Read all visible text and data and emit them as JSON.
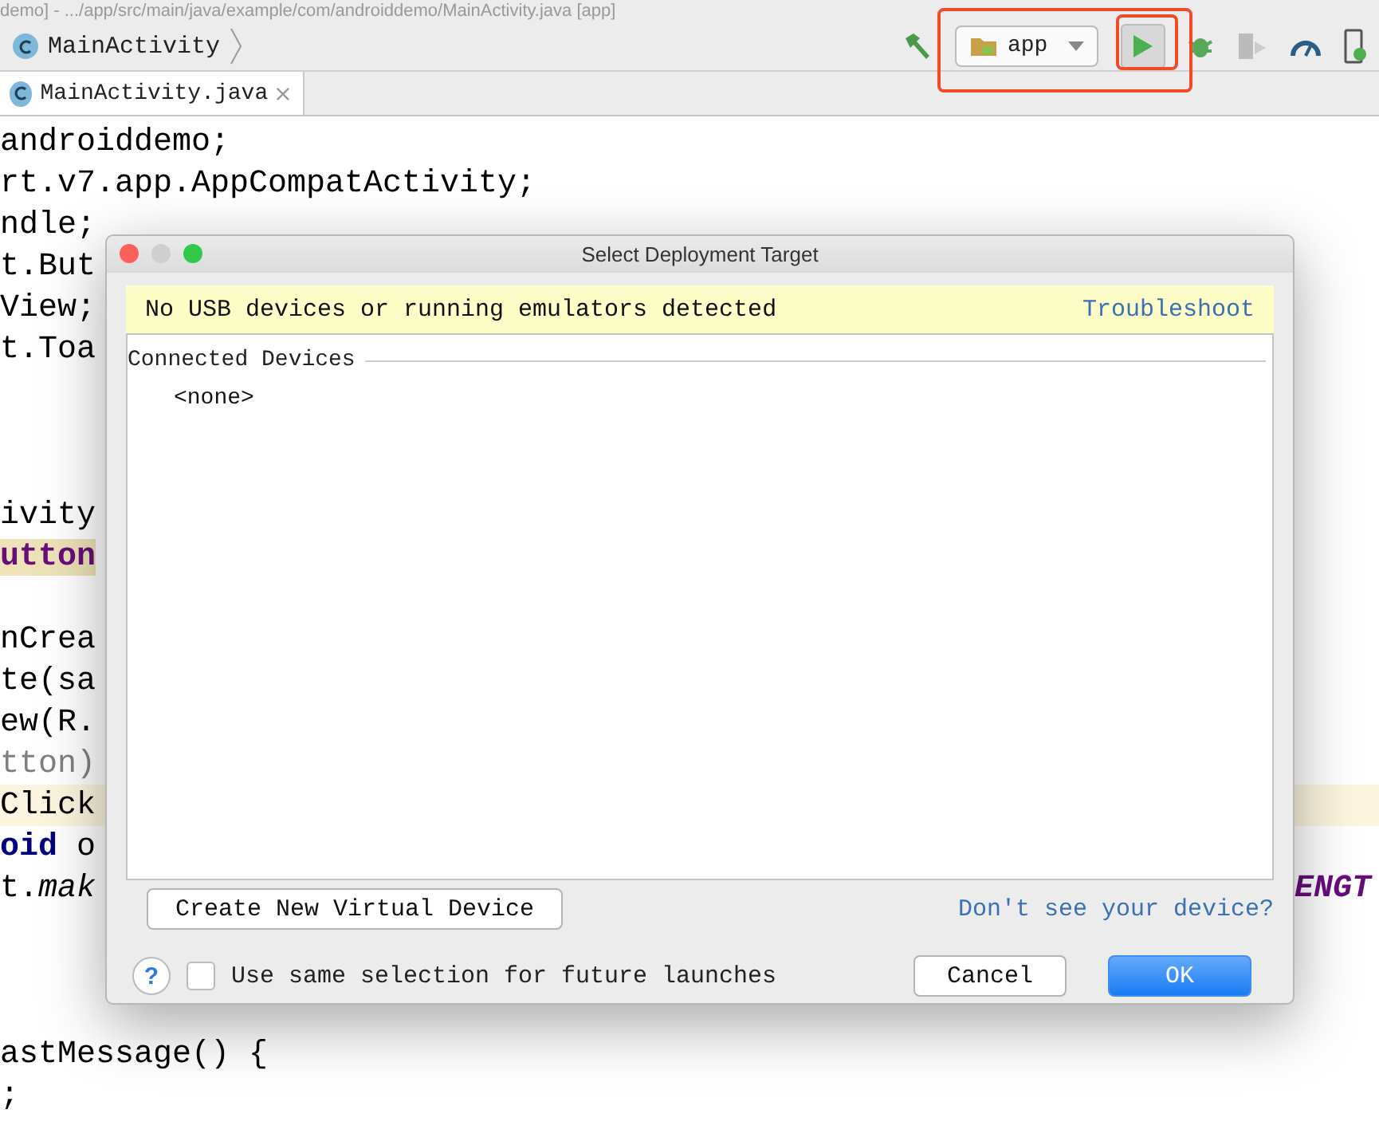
{
  "window": {
    "title": "demo] - .../app/src/main/java/example/com/androiddemo/MainActivity.java [app]"
  },
  "navigation": {
    "breadcrumb": "MainActivity",
    "run_config": "app"
  },
  "tabs": [
    {
      "label": "MainActivity.java",
      "selected": true
    }
  ],
  "editor": {
    "lines": [
      {
        "highlighted": false,
        "segments": [
          {
            "text": "androiddemo;",
            "kind": "plain"
          }
        ]
      },
      {
        "highlighted": false,
        "segments": [
          {
            "text": "rt.v7.app.AppCompatActivity;",
            "kind": "plain"
          }
        ]
      },
      {
        "highlighted": false,
        "segments": [
          {
            "text": "ndle;",
            "kind": "plain"
          }
        ]
      },
      {
        "highlighted": false,
        "segments": [
          {
            "text": "t.But",
            "kind": "plain"
          }
        ]
      },
      {
        "highlighted": false,
        "segments": [
          {
            "text": "View;",
            "kind": "plain"
          }
        ]
      },
      {
        "highlighted": false,
        "segments": [
          {
            "text": "t.Toa",
            "kind": "plain"
          }
        ]
      },
      {
        "highlighted": false
      },
      {
        "highlighted": false
      },
      {
        "highlighted": false
      },
      {
        "highlighted": false,
        "segments": [
          {
            "text": "ivity",
            "kind": "plain"
          }
        ]
      },
      {
        "highlighted": false,
        "segments": [
          {
            "text": "utton",
            "kind": "usage"
          }
        ]
      },
      {
        "highlighted": false
      },
      {
        "highlighted": false,
        "segments": [
          {
            "text": "nCrea",
            "kind": "plain"
          }
        ]
      },
      {
        "highlighted": false,
        "segments": [
          {
            "text": "te(sa",
            "kind": "plain"
          }
        ]
      },
      {
        "highlighted": false,
        "segments": [
          {
            "text": "ew(R.",
            "kind": "plain"
          }
        ]
      },
      {
        "highlighted": false,
        "segments": [
          {
            "text": "tton)",
            "kind": "unused"
          }
        ]
      },
      {
        "highlighted": true,
        "segments": [
          {
            "text": "Click",
            "kind": "plain"
          }
        ]
      },
      {
        "highlighted": false,
        "segments": [
          {
            "text": "oid",
            "kind": "keyword"
          },
          {
            "text": " o",
            "kind": "plain"
          }
        ]
      },
      {
        "highlighted": false,
        "segments": [
          {
            "text": "t.*mak*",
            "kind": "plain"
          }
        ],
        "right_text": "ENGT"
      },
      {
        "highlighted": false
      },
      {
        "highlighted": false
      },
      {
        "highlighted": false
      },
      {
        "highlighted": false,
        "segments": [
          {
            "text": "astMessage() {",
            "kind": "plain"
          }
        ]
      },
      {
        "highlighted": false,
        "segments": [
          {
            "text": ";",
            "kind": "plain"
          }
        ]
      }
    ]
  },
  "dialog": {
    "title": "Select Deployment Target",
    "banner": {
      "message": "No USB devices or running emulators detected",
      "link": "Troubleshoot"
    },
    "section": "Connected Devices",
    "devices": [
      "<none>"
    ],
    "create_button": "Create New Virtual Device",
    "help_link": "Don't see your device?",
    "help_button": "?",
    "remember": {
      "label": "Use same selection for future launches",
      "checked": false
    },
    "buttons": [
      {
        "label": "Cancel",
        "default": false
      },
      {
        "label": "OK",
        "default": true
      }
    ]
  }
}
